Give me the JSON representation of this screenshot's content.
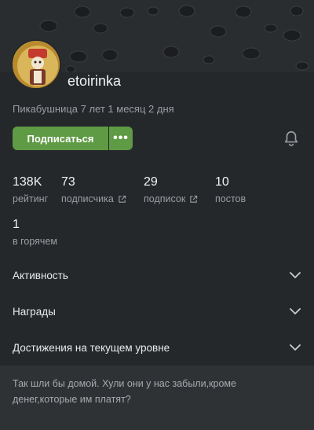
{
  "profile": {
    "username": "etoirinka",
    "tenure": "Пикабушница 7 лет 1 месяц 2 дня"
  },
  "actions": {
    "subscribe_label": "Подписаться",
    "more_label": "•••"
  },
  "stats": [
    {
      "value": "138K",
      "label": "рейтинг"
    },
    {
      "value": "73",
      "label": "подписчика"
    },
    {
      "value": "29",
      "label": "подписок"
    },
    {
      "value": "10",
      "label": "постов"
    },
    {
      "value": "1",
      "label": "в горячем"
    }
  ],
  "sections": [
    {
      "title": "Активность"
    },
    {
      "title": "Награды"
    },
    {
      "title": "Достижения на текущем уровне"
    }
  ],
  "about": "Так шли бы домой. Хули они у нас забыли,кроме денег,которые им платят?",
  "icons": {
    "bell": "bell-icon",
    "chevron": "chevron-down-icon",
    "external": "external-link-icon"
  },
  "colors": {
    "accent": "#5f9a45",
    "background": "#25282b"
  }
}
